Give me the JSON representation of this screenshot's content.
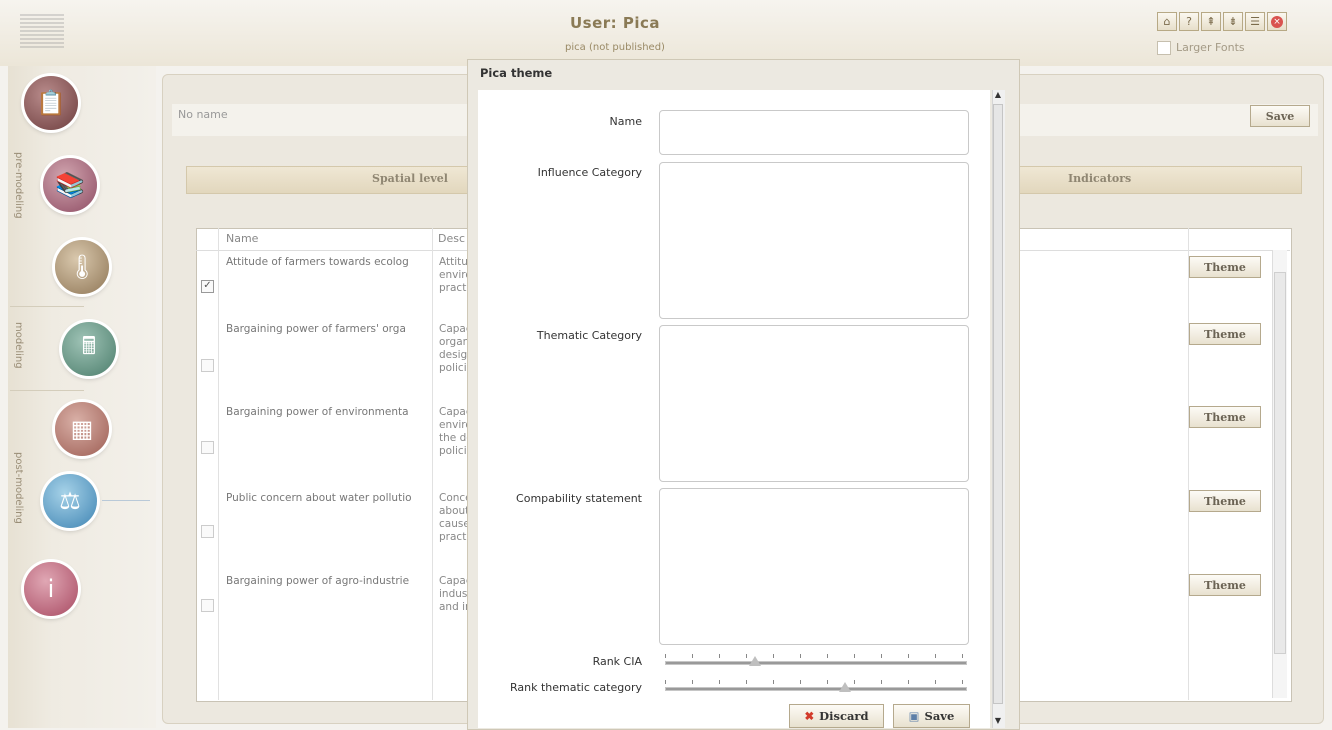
{
  "header": {
    "title": "User: Pica",
    "subtitle": "pica (not published)",
    "larger_fonts_label": "Larger Fonts",
    "toolbar_icons": [
      "home-icon",
      "help-icon",
      "upload-icon",
      "download-icon",
      "users-icon",
      "close-icon"
    ]
  },
  "sidebar": {
    "sections": [
      "pre-modeling",
      "modeling",
      "post-modeling"
    ]
  },
  "main": {
    "name_placeholder": "No name",
    "save_label": "Save",
    "tabs": {
      "spatial": "Spatial level",
      "indicators": "Indicators"
    },
    "columns": {
      "name": "Name",
      "description": "Descri"
    },
    "theme_label": "Theme",
    "rows": [
      {
        "name": "Attitude of farmers towards ecolog",
        "desc": [
          "Attitud",
          "enviro",
          "practic"
        ],
        "checked": true
      },
      {
        "name": "Bargaining power of farmers' orga",
        "desc": [
          "Capac",
          "organi",
          "design",
          "policie"
        ],
        "checked": false
      },
      {
        "name": "Bargaining power of environmenta",
        "desc": [
          "Capac",
          "enviro",
          "the de",
          "policie"
        ],
        "checked": false
      },
      {
        "name": "Public concern about water pollutio",
        "desc": [
          "Conce",
          "about",
          "causel",
          "practic"
        ],
        "checked": false
      },
      {
        "name": "Bargaining power of agro-industrie",
        "desc": [
          "Capac",
          "indust",
          "and im"
        ],
        "checked": false
      }
    ]
  },
  "modal": {
    "title": "Pica theme",
    "fields": {
      "name": "Name",
      "influence": "Influence Category",
      "thematic": "Thematic Category",
      "compatibility": "Compability statement",
      "rank_cia": "Rank CIA",
      "rank_thematic": "Rank thematic category"
    },
    "rank_cia_value": 0.3,
    "rank_thematic_value": 0.6,
    "discard_label": "Discard",
    "save_label": "Save"
  }
}
